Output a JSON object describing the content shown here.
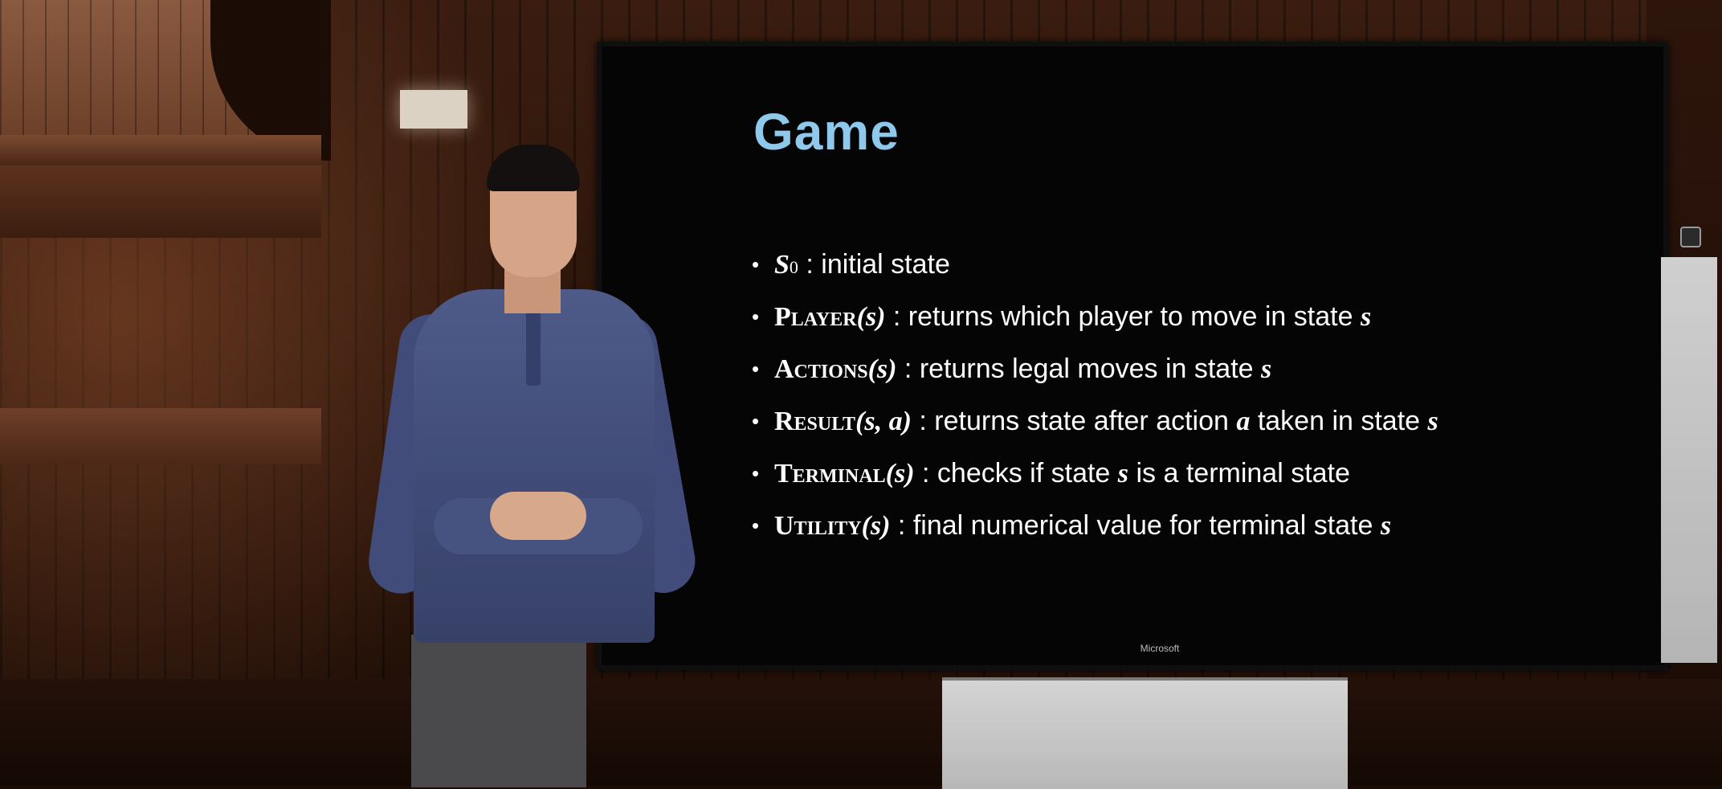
{
  "slide": {
    "title": "Game",
    "items": [
      {
        "fn": "",
        "var": "S",
        "sub": "0",
        "desc": " : initial state"
      },
      {
        "fn": "Player",
        "var": "(s)",
        "desc": " : returns which player to move in state ",
        "tail": "s"
      },
      {
        "fn": "Actions",
        "var": "(s)",
        "desc": " : returns legal moves in state ",
        "tail": "s"
      },
      {
        "fn": "Result",
        "var": "(s, a)",
        "desc": " : returns state after action ",
        "mid": "a",
        "desc2": " taken in state ",
        "tail": "s"
      },
      {
        "fn": "Terminal",
        "var": "(s)",
        "desc": " : checks if state ",
        "mid": "s",
        "desc2": " is a terminal state"
      },
      {
        "fn": "Utility",
        "var": "(s)",
        "desc": " : final numerical value for terminal state ",
        "tail": "s"
      }
    ],
    "bullet_symbol": "•"
  },
  "tv": {
    "brand": "Microsoft"
  },
  "colors": {
    "title": "#8ec9ec",
    "screen": "#050505",
    "text": "#ffffff"
  }
}
